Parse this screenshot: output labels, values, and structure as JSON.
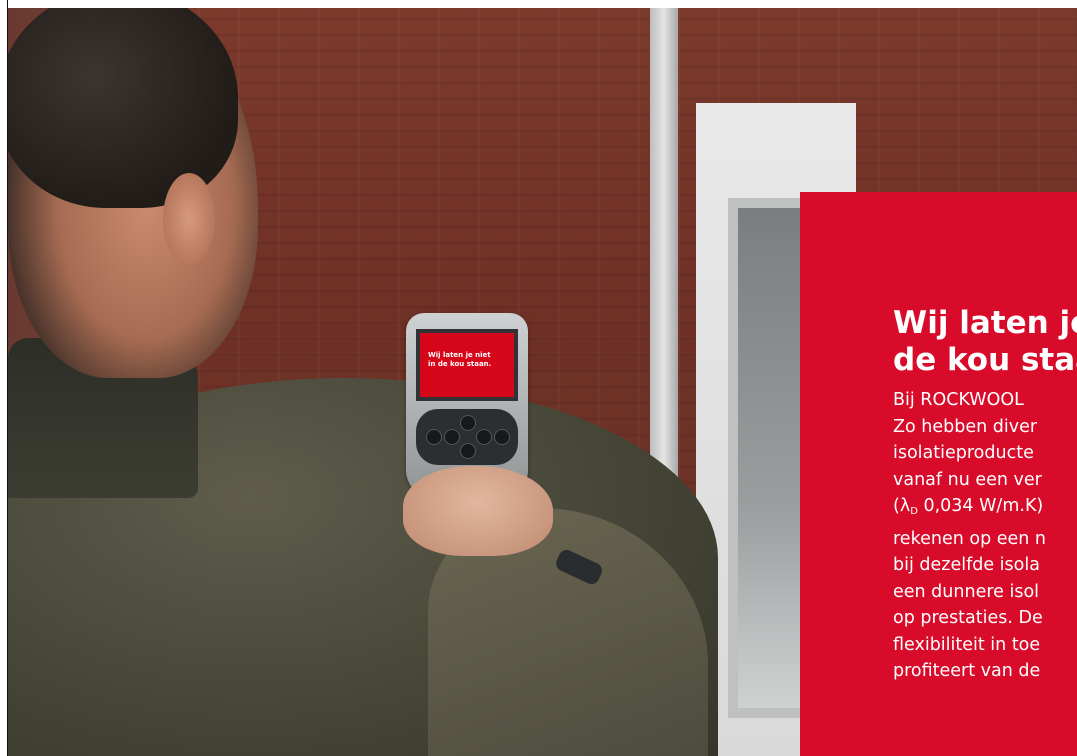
{
  "camera_screen": {
    "line1": "Wij laten je niet",
    "line2": "in de kou staan."
  },
  "panel": {
    "background": "#d90b2a",
    "title_lines": [
      "Wij laten je niet",
      "de kou staan."
    ],
    "body_lines": [
      "Bij ROCKWOOL",
      "Zo hebben diver",
      "isolatieproducte",
      "vanaf nu een ver",
      "0,034 W/m.K",
      "rekenen op een n",
      "bij dezelfde isola",
      "een dunnere isol",
      "op prestaties. De",
      "flexibiliteit in toe",
      "profiteert van de"
    ],
    "lambda_symbol": "λ",
    "lambda_subscript": "D"
  },
  "icons": {
    "camera": "thermal-camera-icon"
  }
}
